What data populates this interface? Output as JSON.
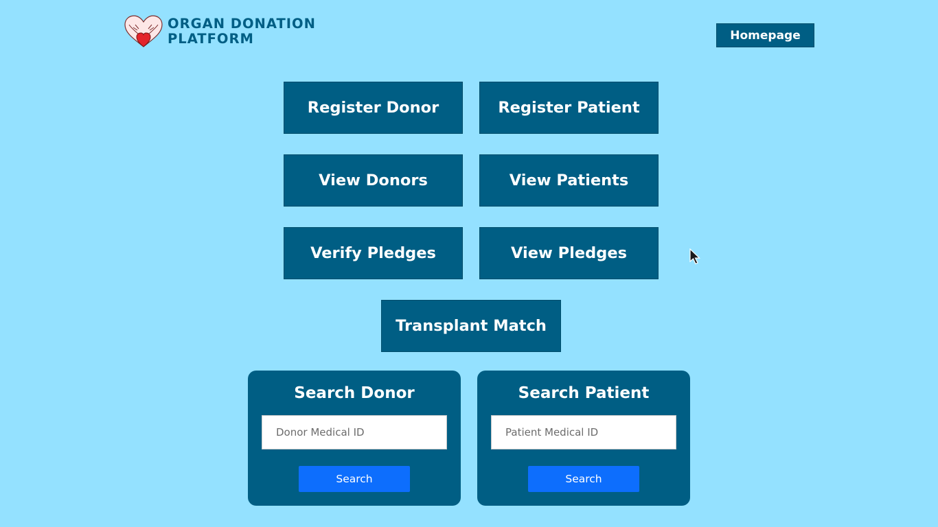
{
  "header": {
    "brand_line1": "ORGAN DONATION",
    "brand_line2": "PLATFORM",
    "logo_icon": "heart-hands-icon",
    "homepage_label": "Homepage"
  },
  "actions": {
    "register_donor": "Register Donor",
    "register_patient": "Register Patient",
    "view_donors": "View Donors",
    "view_patients": "View Patients",
    "verify_pledges": "Verify Pledges",
    "view_pledges": "View Pledges",
    "transplant_match": "Transplant Match"
  },
  "search_donor": {
    "title": "Search Donor",
    "input_value": "",
    "placeholder": "Donor Medical ID",
    "button_label": "Search"
  },
  "search_patient": {
    "title": "Search Patient",
    "input_value": "",
    "placeholder": "Patient Medical ID",
    "button_label": "Search"
  },
  "colors": {
    "background": "#94e1ff",
    "primary": "#005e84",
    "search_button": "#0d6efd",
    "logo_heart": "#e3242b"
  }
}
